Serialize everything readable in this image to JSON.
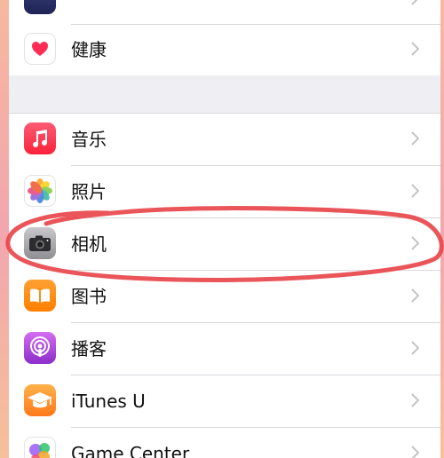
{
  "settings_list": {
    "items": [
      {
        "label": "",
        "icon": "dark-app-icon-partial"
      },
      {
        "label": "健康",
        "icon": "heart-icon"
      },
      {
        "label": "音乐",
        "icon": "music-note-icon"
      },
      {
        "label": "照片",
        "icon": "photos-flower-icon"
      },
      {
        "label": "相机",
        "icon": "camera-icon"
      },
      {
        "label": "图书",
        "icon": "book-icon"
      },
      {
        "label": "播客",
        "icon": "podcast-icon"
      },
      {
        "label": "iTunes U",
        "icon": "graduation-cap-icon"
      },
      {
        "label": "Game Center",
        "icon": "game-center-bubbles-icon"
      }
    ]
  },
  "annotation": {
    "color": "#e8464b",
    "target": "相机"
  }
}
